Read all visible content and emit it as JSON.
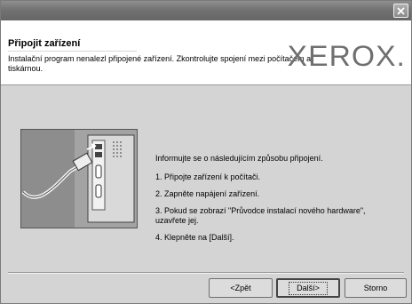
{
  "window": {
    "close_glyph": "×"
  },
  "header": {
    "title": "Připojit zařízení",
    "description": "Instalační program nenalezl připojené zařízení. Zkontrolujte spojení mezi počítačem a tiskárnou.",
    "logo": "XEROX."
  },
  "content": {
    "intro": "Informujte se o následujícím způsobu připojení.",
    "steps": [
      "1. Připojte zařízení k počítači.",
      "2. Zapněte napájení zařízení.",
      "3. Pokud se zobrazí \"Průvodce instalací nového hardware\", uzavřete jej.",
      "4. Klepněte na [Další]."
    ]
  },
  "buttons": {
    "back": "<Zpět",
    "next": "Další>",
    "cancel": "Storno"
  },
  "icons": {
    "close": "close-icon",
    "illustration": "usb-connection-illustration"
  }
}
